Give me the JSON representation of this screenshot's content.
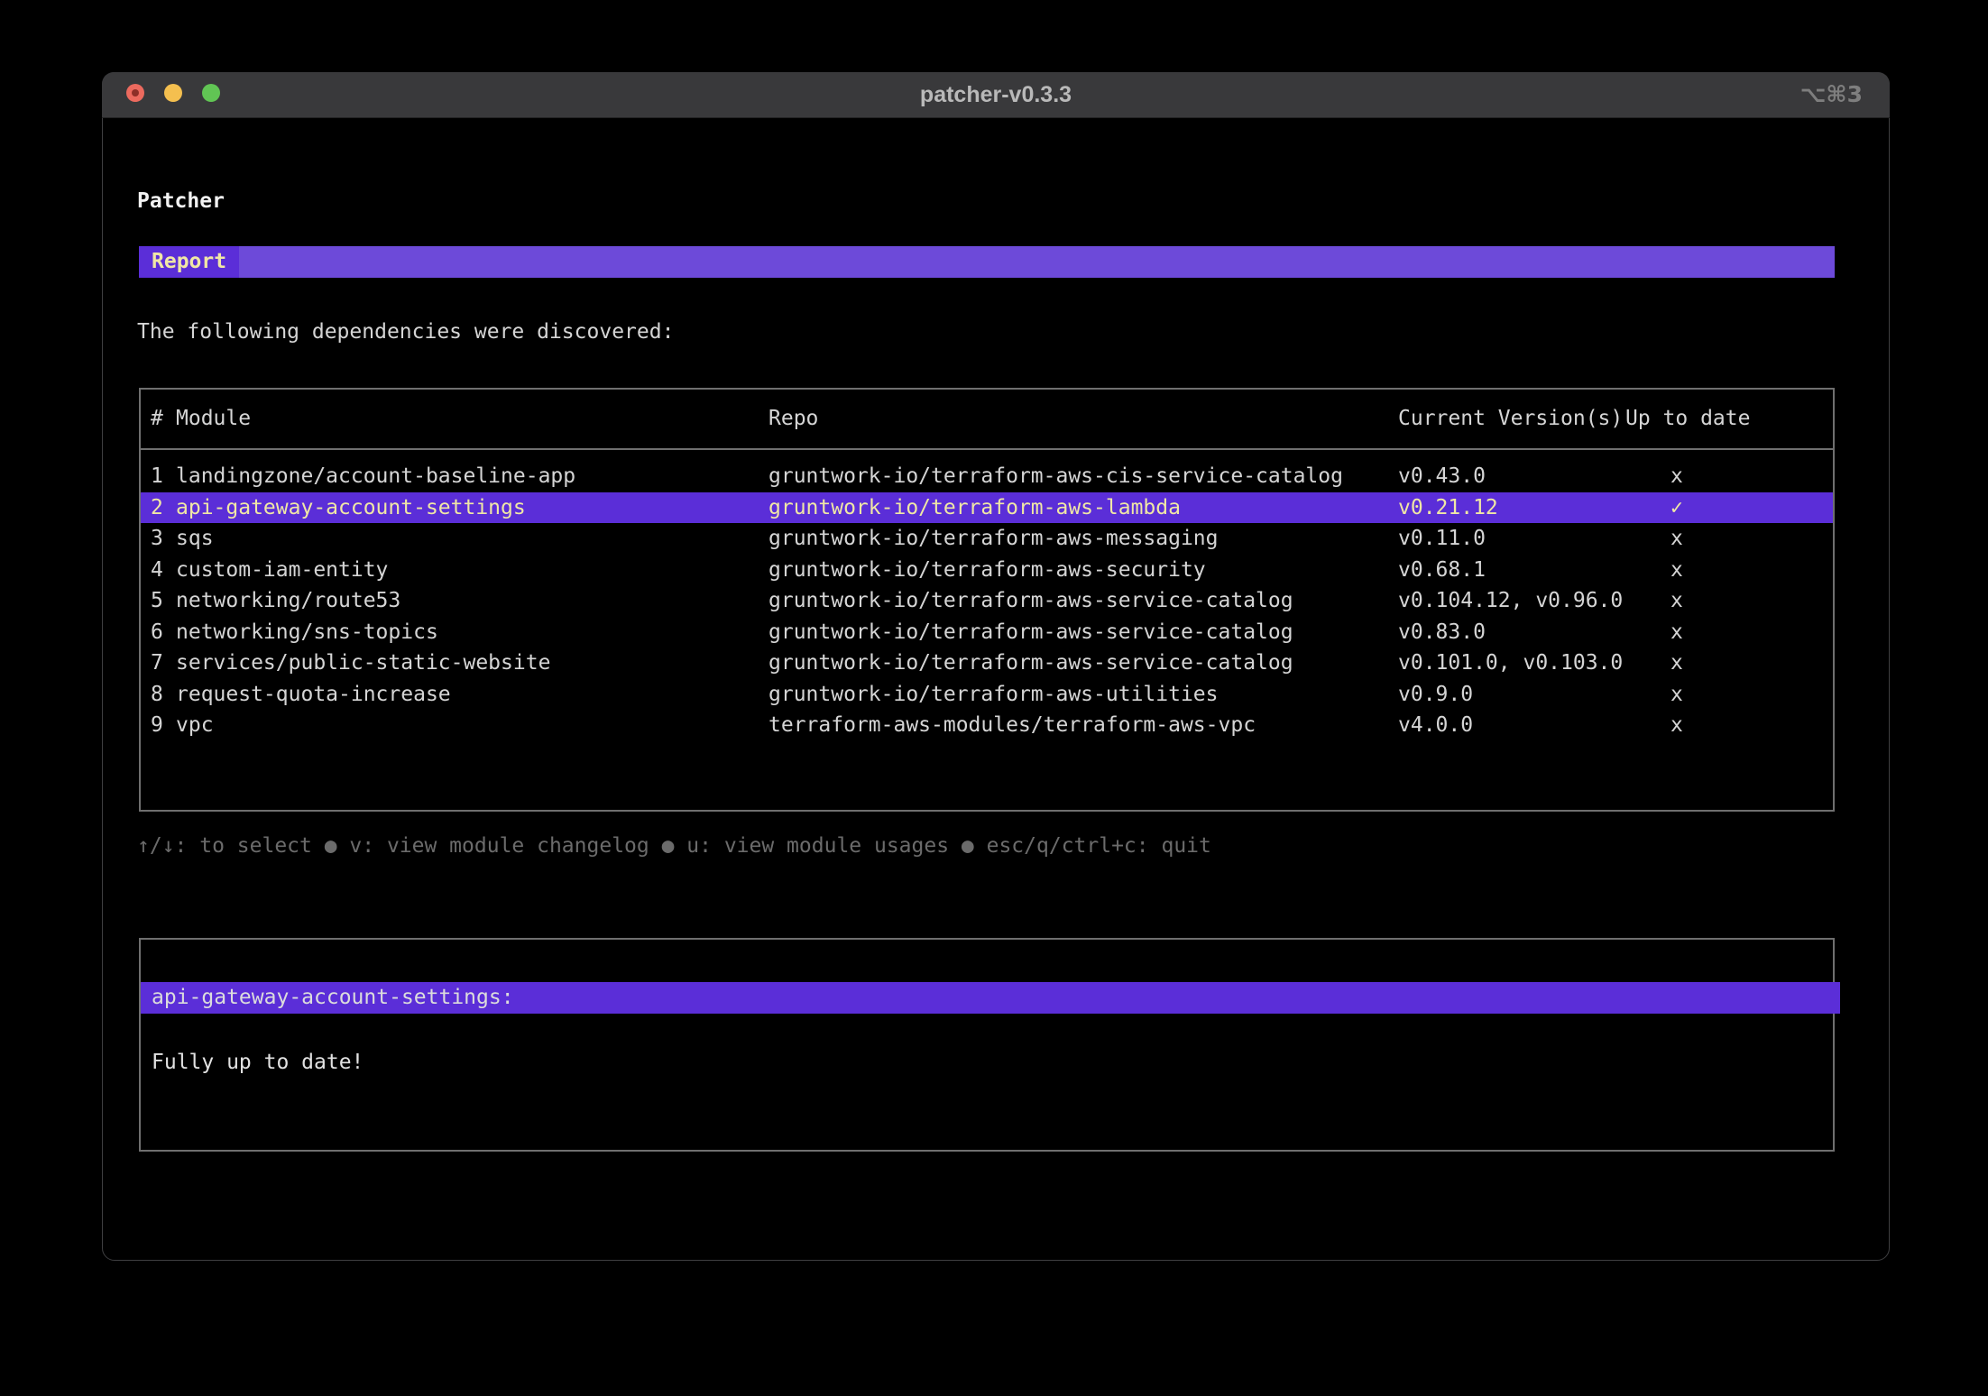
{
  "window": {
    "title": "patcher-v0.3.3",
    "shortcut": "⌥⌘3"
  },
  "app": {
    "heading": "Patcher",
    "tab_label": "Report",
    "intro": "The following dependencies were discovered:"
  },
  "table": {
    "columns": [
      "#",
      "Module",
      "Repo",
      "Current Version(s)",
      "Up to date"
    ],
    "rows": [
      {
        "num": "1",
        "module": "landingzone/account-baseline-app",
        "repo": "gruntwork-io/terraform-aws-cis-service-catalog",
        "versions": "v0.43.0",
        "status": "x",
        "selected": false
      },
      {
        "num": "2",
        "module": "api-gateway-account-settings",
        "repo": "gruntwork-io/terraform-aws-lambda",
        "versions": "v0.21.12",
        "status": "✓",
        "selected": true
      },
      {
        "num": "3",
        "module": "sqs",
        "repo": "gruntwork-io/terraform-aws-messaging",
        "versions": "v0.11.0",
        "status": "x",
        "selected": false
      },
      {
        "num": "4",
        "module": "custom-iam-entity",
        "repo": "gruntwork-io/terraform-aws-security",
        "versions": "v0.68.1",
        "status": "x",
        "selected": false
      },
      {
        "num": "5",
        "module": "networking/route53",
        "repo": "gruntwork-io/terraform-aws-service-catalog",
        "versions": "v0.104.12, v0.96.0",
        "status": "x",
        "selected": false
      },
      {
        "num": "6",
        "module": "networking/sns-topics",
        "repo": "gruntwork-io/terraform-aws-service-catalog",
        "versions": "v0.83.0",
        "status": "x",
        "selected": false
      },
      {
        "num": "7",
        "module": "services/public-static-website",
        "repo": "gruntwork-io/terraform-aws-service-catalog",
        "versions": "v0.101.0, v0.103.0",
        "status": "x",
        "selected": false
      },
      {
        "num": "8",
        "module": "request-quota-increase",
        "repo": "gruntwork-io/terraform-aws-utilities",
        "versions": "v0.9.0",
        "status": "x",
        "selected": false
      },
      {
        "num": "9",
        "module": "vpc",
        "repo": "terraform-aws-modules/terraform-aws-vpc",
        "versions": "v4.0.0",
        "status": "x",
        "selected": false
      }
    ]
  },
  "help_text": "↑/↓: to select ● v: view module changelog ● u: view module usages ● esc/q/ctrl+c: quit",
  "detail": {
    "title": "api-gateway-account-settings:",
    "body": "Fully up to date!"
  },
  "colors": {
    "selection_purple": "#5b2ed8",
    "tab_bar_purple": "#6d4ad9",
    "cream_text": "#f0e7a6",
    "titlebar_bg": "#39393b",
    "border_gray": "#6f6f6f",
    "help_gray": "#6b6b6b",
    "traffic_red": "#ec6a5e",
    "traffic_yellow": "#f4bf4f",
    "traffic_green": "#61c554"
  }
}
